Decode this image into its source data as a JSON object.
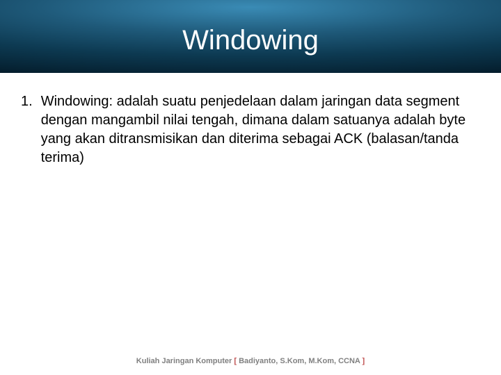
{
  "slide": {
    "title": "Windowing",
    "items": [
      {
        "number": "1.",
        "text": "Windowing: adalah suatu penjedelaan dalam jaringan data segment dengan mangambil nilai tengah, dimana dalam satuanya adalah byte yang akan ditransmisikan dan diterima sebagai ACK (balasan/tanda terima)"
      }
    ],
    "footer": {
      "prefix": "Kuliah Jaringan Komputer ",
      "bracket_open": "[ ",
      "author": "Badiyanto, S.Kom, M.Kom, CCNA",
      "bracket_close": " ]"
    }
  }
}
